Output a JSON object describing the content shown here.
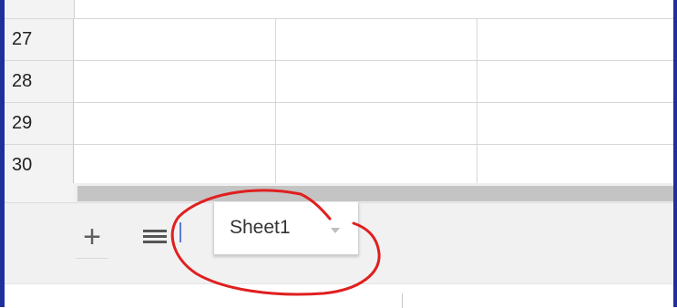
{
  "grid": {
    "rows": [
      {
        "number": "27"
      },
      {
        "number": "28"
      },
      {
        "number": "29"
      },
      {
        "number": "30"
      }
    ]
  },
  "sheet_bar": {
    "add_sheet_icon": "plus-icon",
    "add_sheet_glyph": "+",
    "all_sheets_icon": "list-icon",
    "tabs": [
      {
        "name": "Sheet1",
        "menu_icon": "dropdown-arrow-icon"
      }
    ]
  },
  "annotation": {
    "shape": "hand-drawn-ellipse",
    "color": "#e01f1f",
    "target": "Sheet1 tab"
  },
  "colors": {
    "frame": "#1f2f9e",
    "header_bg": "#f3f3f3",
    "sheetbar_bg": "#f1f1f1",
    "scroll_thumb": "#c4c4c4"
  }
}
